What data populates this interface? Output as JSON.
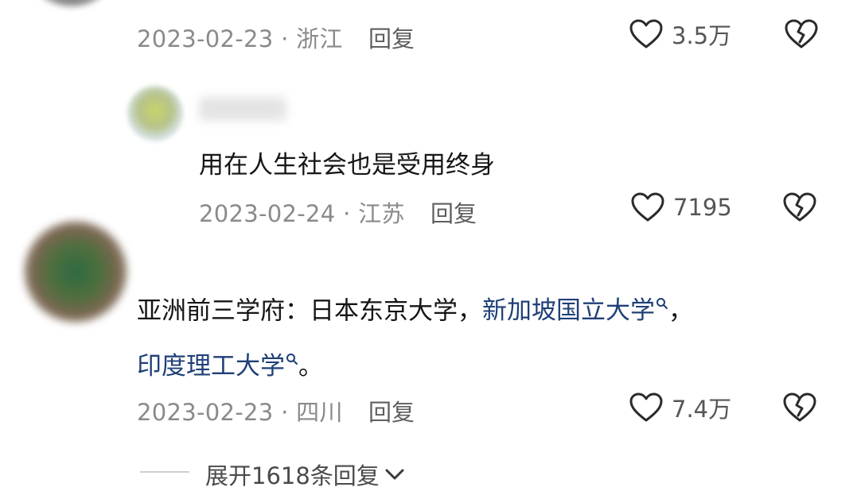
{
  "comments": [
    {
      "date": "2023-02-23",
      "location": "浙江",
      "reply_label": "回复",
      "likes": "3.5万"
    },
    {
      "text": "用在人生社会也是受用终身",
      "date": "2023-02-24",
      "location": "江苏",
      "reply_label": "回复",
      "likes": "7195"
    },
    {
      "text_prefix": "亚洲前三学府：日本东京大学，",
      "link1": "新加坡国立大学",
      "text_mid": "，",
      "link2": "印度理工大学",
      "text_suffix": "。",
      "date": "2023-02-23",
      "location": "四川",
      "reply_label": "回复",
      "likes": "7.4万"
    }
  ],
  "expand_replies": "展开1618条回复",
  "separator": "·",
  "colors": {
    "link": "#1f3f77",
    "meta": "#8a8a8a",
    "text": "#151515"
  },
  "icons": [
    "heart-icon",
    "dislike-broken-heart-icon",
    "search-icon",
    "chevron-down-icon"
  ]
}
